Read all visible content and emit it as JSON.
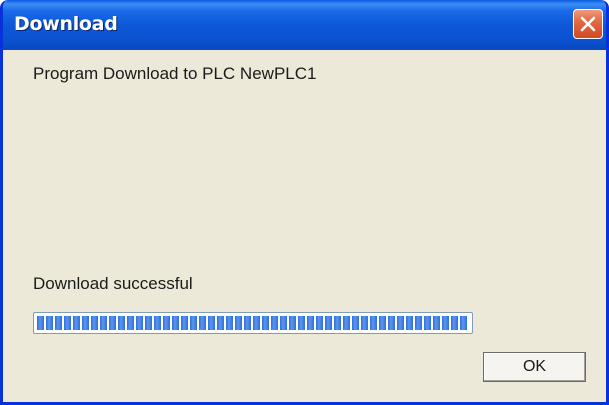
{
  "window": {
    "title": "Download"
  },
  "dialog": {
    "message": "Program Download to PLC NewPLC1",
    "status": "Download successful",
    "progress_percent": 100,
    "ok_label": "OK"
  },
  "icons": {
    "close": "close-icon"
  },
  "colors": {
    "titlebar": "#0b52d0",
    "window_border": "#0831d9",
    "client_background": "#ece9d8",
    "progress_fill": "#2f6fd8",
    "close_button": "#e26a44"
  }
}
